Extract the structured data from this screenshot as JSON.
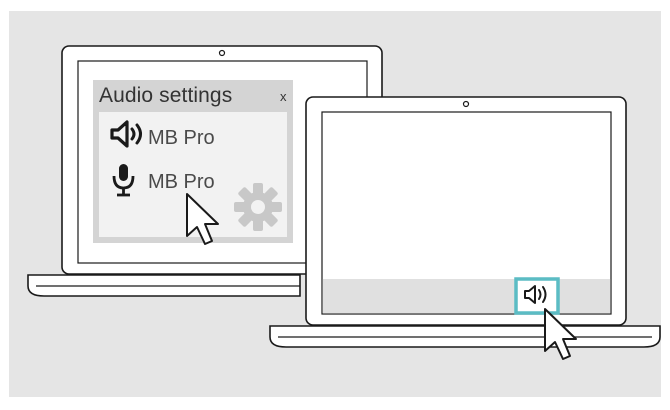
{
  "audio_settings": {
    "title": "Audio settings",
    "close_label": "x",
    "devices": [
      {
        "icon": "speaker-icon",
        "label": "MB Pro"
      },
      {
        "icon": "microphone-icon",
        "label": "MB Pro"
      }
    ],
    "settings_icon": "gear-icon"
  },
  "taskbar": {
    "highlighted_icon": "speaker-icon",
    "highlight_color": "#5bbcc4"
  },
  "colors": {
    "background": "#e5e5e5",
    "laptop_outline": "#1a1a1a",
    "dialog_panel": "#d4d4d4",
    "dialog_inner": "#f2f2f2",
    "gear": "#c8c8c8"
  }
}
